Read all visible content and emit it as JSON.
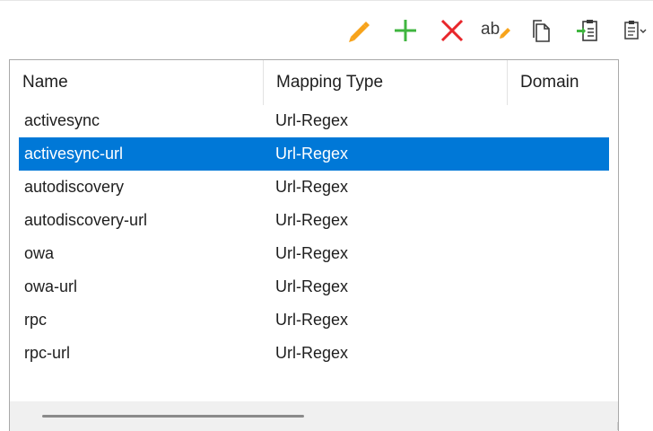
{
  "toolbar": {
    "buttons": [
      {
        "name": "edit-button",
        "icon": "pencil-icon",
        "color": "#f7a31b"
      },
      {
        "name": "add-button",
        "icon": "plus-icon",
        "color": "#3fb53f"
      },
      {
        "name": "delete-button",
        "icon": "close-icon",
        "color": "#e8262b"
      },
      {
        "name": "rename-button",
        "icon": "rename-icon",
        "label": "ab"
      },
      {
        "name": "copy-button",
        "icon": "copy-icon"
      },
      {
        "name": "paste-button",
        "icon": "paste-icon",
        "color": "#3fb53f"
      },
      {
        "name": "clipboard-dropdown-button",
        "icon": "clipboard-icon"
      }
    ]
  },
  "table": {
    "columns": [
      "Name",
      "Mapping Type",
      "Domain"
    ],
    "selected_index": 1,
    "selection_color": "#0078d7",
    "rows": [
      {
        "name": "activesync",
        "type": "Url-Regex",
        "domain": ""
      },
      {
        "name": "activesync-url",
        "type": "Url-Regex",
        "domain": ""
      },
      {
        "name": "autodiscovery",
        "type": "Url-Regex",
        "domain": ""
      },
      {
        "name": "autodiscovery-url",
        "type": "Url-Regex",
        "domain": ""
      },
      {
        "name": "owa",
        "type": "Url-Regex",
        "domain": ""
      },
      {
        "name": "owa-url",
        "type": "Url-Regex",
        "domain": ""
      },
      {
        "name": "rpc",
        "type": "Url-Regex",
        "domain": ""
      },
      {
        "name": "rpc-url",
        "type": "Url-Regex",
        "domain": ""
      }
    ]
  }
}
